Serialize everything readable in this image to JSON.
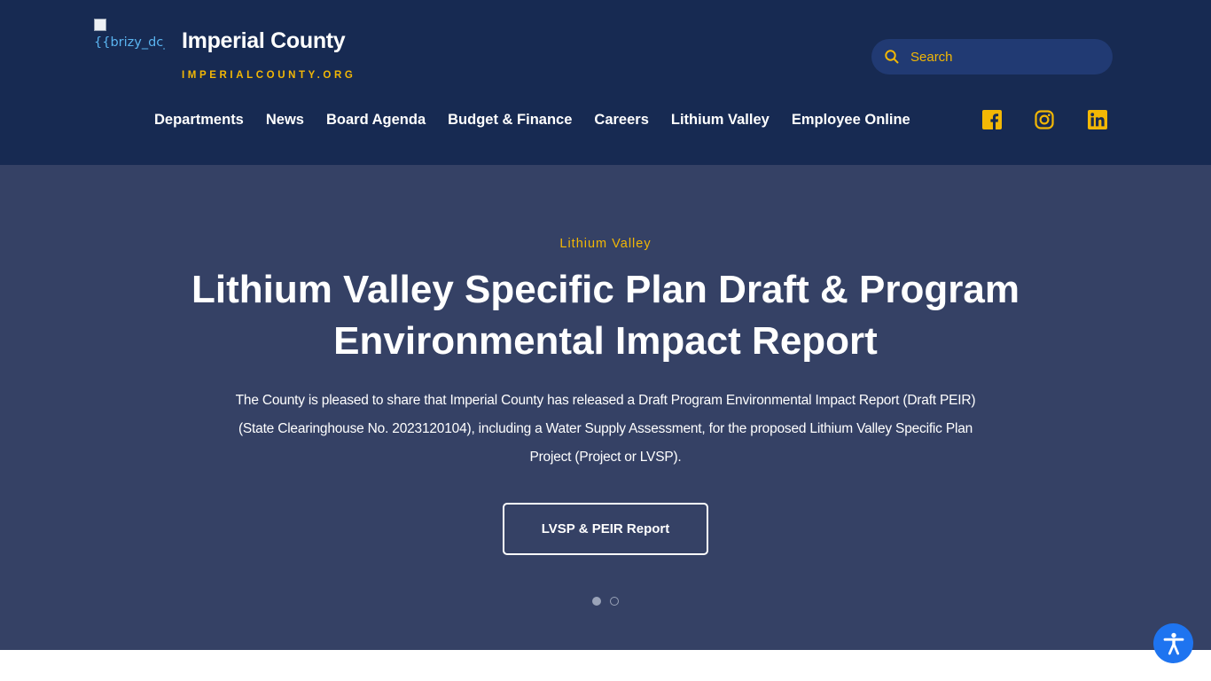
{
  "header": {
    "logo_alt": "{{brizy_dc_imageSrc=",
    "site_title": "Imperial County",
    "site_subtitle": "IMPERIALCOUNTY.ORG",
    "search": {
      "placeholder": "Search",
      "icon": "search-icon"
    },
    "nav": [
      {
        "label": "Departments"
      },
      {
        "label": "News"
      },
      {
        "label": "Board Agenda"
      },
      {
        "label": "Budget & Finance"
      },
      {
        "label": "Careers"
      },
      {
        "label": "Lithium Valley"
      },
      {
        "label": "Employee Online"
      }
    ],
    "social": [
      {
        "icon": "facebook-icon"
      },
      {
        "icon": "instagram-icon"
      },
      {
        "icon": "linkedin-icon"
      }
    ]
  },
  "hero": {
    "eyebrow": "Lithium Valley",
    "title": "Lithium Valley Specific Plan Draft & Program Environmental Impact Report",
    "body": "The County is pleased to share that Imperial County has released a Draft Program Environmental Impact Report (Draft PEIR) (State Clearinghouse No. 2023120104), including a Water Supply Assessment, for the proposed Lithium Valley Specific Plan Project (Project or LVSP).",
    "cta_label": "LVSP & PEIR Report",
    "slides_total": 2,
    "active_slide": 1
  },
  "accessibility": {
    "icon": "accessibility-icon"
  },
  "colors": {
    "header_bg": "#172a52",
    "hero_bg": "#354165",
    "accent": "#f2b705",
    "search_bg": "#213a73",
    "a11y_button": "#1e74f0"
  }
}
